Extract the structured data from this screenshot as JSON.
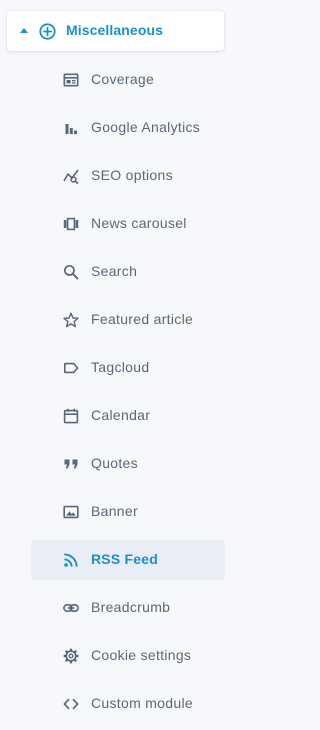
{
  "section": {
    "title": "Miscellaneous",
    "expanded": true,
    "accent_color": "#1a8fd1"
  },
  "items": [
    {
      "label": "Coverage",
      "icon": "coverage-icon"
    },
    {
      "label": "Google Analytics",
      "icon": "bar-chart-icon"
    },
    {
      "label": "SEO options",
      "icon": "seo-chart-icon"
    },
    {
      "label": "News carousel",
      "icon": "carousel-icon"
    },
    {
      "label": "Search",
      "icon": "search-icon"
    },
    {
      "label": "Featured article",
      "icon": "star-icon"
    },
    {
      "label": "Tagcloud",
      "icon": "tag-icon"
    },
    {
      "label": "Calendar",
      "icon": "calendar-icon"
    },
    {
      "label": "Quotes",
      "icon": "quote-icon"
    },
    {
      "label": "Banner",
      "icon": "image-icon"
    },
    {
      "label": "RSS Feed",
      "icon": "rss-icon",
      "active": true
    },
    {
      "label": "Breadcrumb",
      "icon": "link-icon"
    },
    {
      "label": "Cookie settings",
      "icon": "gear-icon"
    },
    {
      "label": "Custom module",
      "icon": "code-icon"
    }
  ],
  "colors": {
    "text": "#5a6779",
    "icon": "#5a6779",
    "active_background": "#e8edf6",
    "panel_background": "#f7f8fb"
  }
}
